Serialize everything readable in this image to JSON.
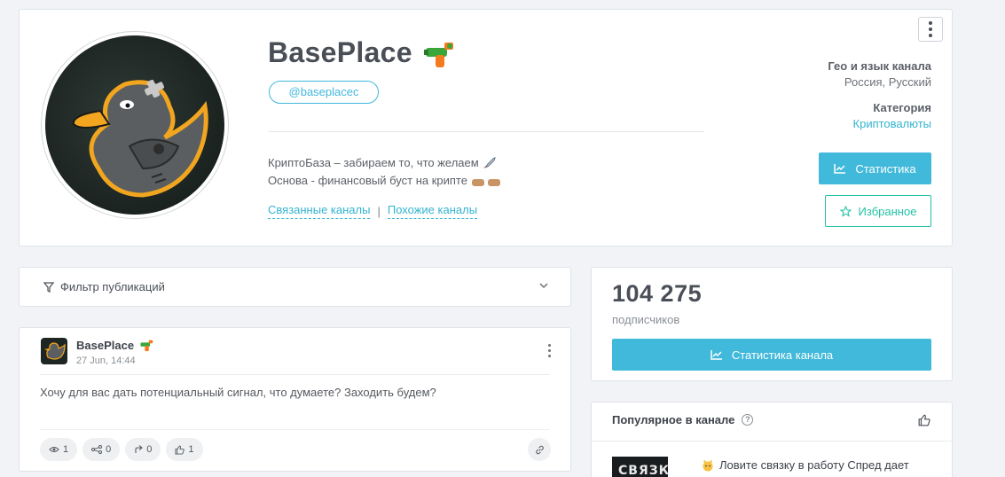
{
  "header": {
    "title": "BasePlace",
    "username": "@baseplacec",
    "description_line1": "КриптоБаза – забираем то, что желаем",
    "description_line2": "Основа - финансовый буст на крипте",
    "link_related": "Связанные каналы",
    "link_separator": "|",
    "link_similar": "Похожие каналы",
    "geo_label": "Гео и язык канала",
    "geo_value": "Россия, Русский",
    "category_label": "Категория",
    "category_value": "Криптовалюты",
    "stats_button": "Статистика",
    "favorite_button": "Избранное",
    "icons": [
      "water-gun-emoji",
      "rocket-emoji",
      "fist-bump-emoji",
      "more-vertical-icon",
      "chart-line-icon",
      "star-icon"
    ],
    "colors": {
      "accent": "#41b9da",
      "favorite": "#22c2a6",
      "link": "#33b4d0"
    }
  },
  "filter": {
    "label": "Фильтр публикаций",
    "icons": [
      "filter-icon",
      "chevron-down-icon"
    ]
  },
  "post": {
    "author": "BasePlace",
    "date": "27 Jun, 14:44",
    "text": "Хочу для вас дать потенциальный сигнал, что думаете? Заходить будем?",
    "stats": {
      "views": "1",
      "shares": "0",
      "forwards": "0",
      "likes": "1"
    },
    "icons": [
      "eye-icon",
      "share-icon",
      "forward-icon",
      "thumbs-up-icon",
      "link-icon"
    ]
  },
  "subscribers": {
    "count": "104 275",
    "label": "подписчиков",
    "button": "Статистика канала"
  },
  "popular": {
    "title": "Популярное в канале",
    "item_thumb": "СВЯЗКА",
    "item_text": "Ловите связку в работу Спред дает"
  }
}
